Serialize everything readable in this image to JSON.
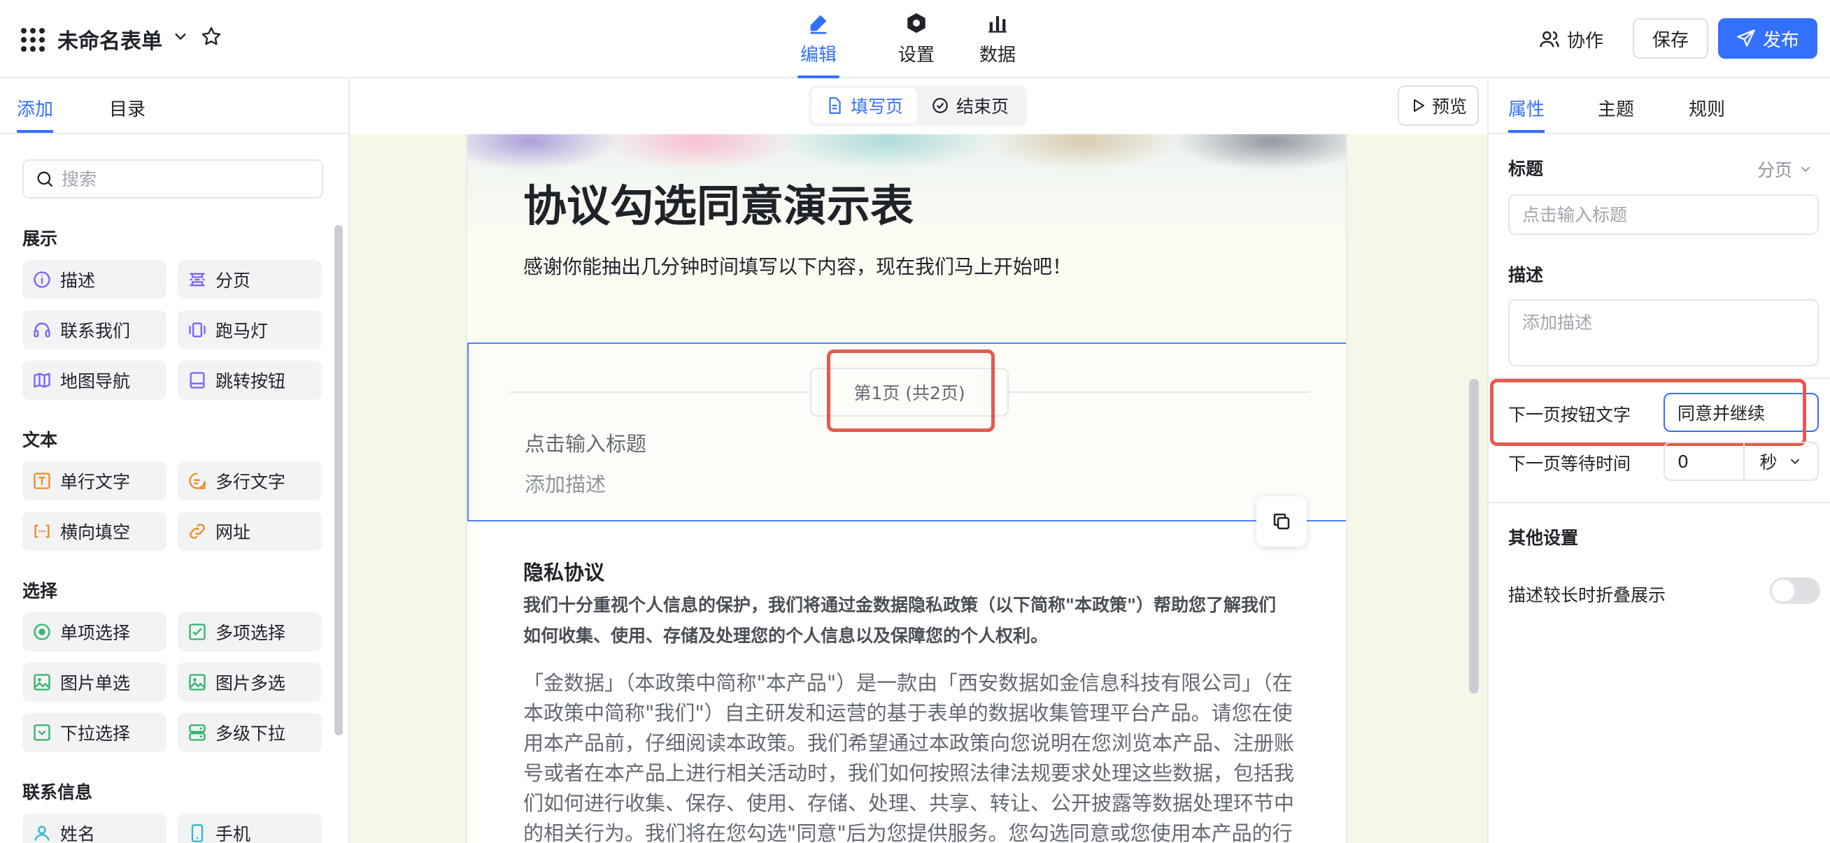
{
  "header": {
    "doc_title": "未命名表单",
    "mode_tabs": [
      {
        "label": "编辑",
        "icon": "pencil-icon",
        "active": true
      },
      {
        "label": "设置",
        "icon": "hexagon-settings-icon",
        "active": false
      },
      {
        "label": "数据",
        "icon": "bar-chart-icon",
        "active": false
      }
    ],
    "collab_label": "协作",
    "save_label": "保存",
    "publish_label": "发布",
    "accent_color": "#3370ff"
  },
  "left_panel": {
    "tabs": [
      "添加",
      "目录"
    ],
    "search_placeholder": "搜索",
    "sections": [
      {
        "title": "展示",
        "items": [
          {
            "label": "描述",
            "icon": "info-circle-icon"
          },
          {
            "label": "分页",
            "icon": "page-break-icon"
          },
          {
            "label": "联系我们",
            "icon": "headset-icon"
          },
          {
            "label": "跑马灯",
            "icon": "carousel-icon"
          },
          {
            "label": "地图导航",
            "icon": "map-icon"
          },
          {
            "label": "跳转按钮",
            "icon": "button-icon"
          }
        ]
      },
      {
        "title": "文本",
        "items": [
          {
            "label": "单行文字",
            "icon": "text-input-icon"
          },
          {
            "label": "多行文字",
            "icon": "textarea-icon"
          },
          {
            "label": "横向填空",
            "icon": "fill-blank-icon"
          },
          {
            "label": "网址",
            "icon": "link-icon"
          }
        ]
      },
      {
        "title": "选择",
        "items": [
          {
            "label": "单项选择",
            "icon": "radio-icon"
          },
          {
            "label": "多项选择",
            "icon": "checkbox-icon"
          },
          {
            "label": "图片单选",
            "icon": "image-radio-icon"
          },
          {
            "label": "图片多选",
            "icon": "image-checkbox-icon"
          },
          {
            "label": "下拉选择",
            "icon": "dropdown-icon"
          },
          {
            "label": "多级下拉",
            "icon": "cascade-dropdown-icon"
          }
        ]
      },
      {
        "title": "联系信息",
        "items": [
          {
            "label": "姓名",
            "icon": "person-icon"
          },
          {
            "label": "手机",
            "icon": "phone-icon"
          }
        ]
      }
    ]
  },
  "canvas": {
    "page_switch": [
      "填写页",
      "结束页"
    ],
    "preview_label": "预览",
    "form_title": "协议勾选同意演示表",
    "form_subtitle": "感谢你能抽出几分钟时间填写以下内容，现在我们马上开始吧！",
    "page_indicator": "第1页 (共2页)",
    "page_title_placeholder": "点击输入标题",
    "page_desc_placeholder": "添加描述",
    "privacy_title": "隐私协议",
    "privacy_bold": "我们十分重视个人信息的保护，我们将通过金数据隐私政策（以下简称\"本政策\"）帮助您了解我们如何收集、使用、存储及处理您的个人信息以及保障您的个人权利。",
    "privacy_body": "「金数据」（本政策中简称\"本产品\"）是一款由「西安数据如金信息科技有限公司」（在本政策中简称\"我们\"）自主研发和运营的基于表单的数据收集管理平台产品。请您在使用本产品前，仔细阅读本政策。我们希望通过本政策向您说明在您浏览本产品、注册账号或者在本产品上进行相关活动时，我们如何按照法律法规要求处理这些数据，包括我们如何进行收集、保存、使用、存储、处理、共享、转让、公开披露等数据处理环节中的相关行为。我们将在您勾选\"同意\"后为您提供服务。您勾选同意或您使用本产品的行",
    "highlight_color": "#e45a4b"
  },
  "right_panel": {
    "tabs": [
      "属性",
      "主题",
      "规则"
    ],
    "title_label": "标题",
    "paging_label": "分页",
    "title_placeholder": "点击输入标题",
    "desc_label": "描述",
    "desc_placeholder": "添加描述",
    "next_btn_label": "下一页按钮文字",
    "next_btn_value": "同意并继续",
    "wait_label": "下一页等待时间",
    "wait_value": "0",
    "wait_unit": "秒",
    "other_label": "其他设置",
    "collapse_label": "描述较长时折叠展示",
    "collapse_enabled": false
  }
}
